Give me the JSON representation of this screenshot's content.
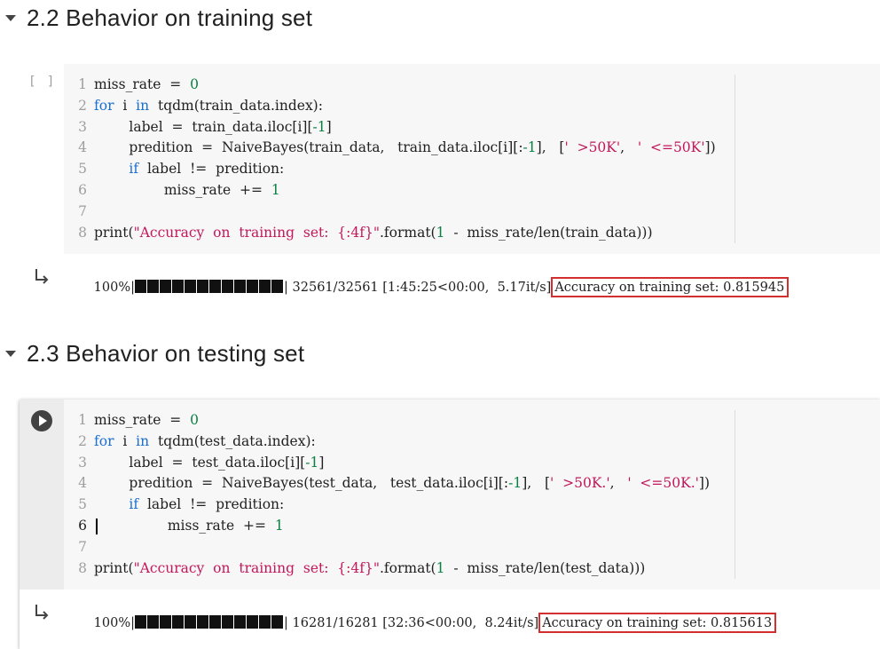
{
  "sections": [
    {
      "title": "2.2 Behavior on training set",
      "cell": {
        "state_marker": "[ ]",
        "lines": [
          "1",
          "2",
          "3",
          "4",
          "5",
          "6",
          "7",
          "8"
        ],
        "output": {
          "percent": "100%",
          "progress": 1.0,
          "stats": " 32561/32561 [1:45:25<00:00,  5.17it/s]",
          "result": "Accuracy on training set: 0.815945"
        }
      }
    },
    {
      "title": "2.3 Behavior on testing set",
      "cell": {
        "lines": [
          "1",
          "2",
          "3",
          "4",
          "5",
          "6",
          "7",
          "8"
        ],
        "output": {
          "percent": "100%",
          "progress": 1.0,
          "stats": " 16281/16281 [32:36<00:00,  8.24it/s]",
          "result": "Accuracy on training set: 0.815613"
        }
      }
    }
  ],
  "code_train": [
    [
      [
        "miss_rate  =  ",
        ""
      ],
      [
        "0",
        "num"
      ]
    ],
    [
      [
        "for",
        "kw"
      ],
      [
        "  i  ",
        ""
      ],
      [
        "in",
        "kw"
      ],
      [
        "  tqdm(train_data.index):",
        ""
      ]
    ],
    [
      [
        "        label  =  train_data.iloc[i][",
        ""
      ],
      [
        "-1",
        "num"
      ],
      [
        "]",
        ""
      ]
    ],
    [
      [
        "        predition  =  NaiveBayes(train_data,   train_data.iloc[i][:",
        ""
      ],
      [
        "-1",
        "num"
      ],
      [
        "],   [",
        ""
      ],
      [
        "'  >50K'",
        "str"
      ],
      [
        ",   ",
        ""
      ],
      [
        "'  <=50K'",
        "str"
      ],
      [
        "])",
        ""
      ]
    ],
    [
      [
        "        ",
        ""
      ],
      [
        "if",
        "kw"
      ],
      [
        "  label  !=  predition:",
        ""
      ]
    ],
    [
      [
        "                miss_rate  +=  ",
        ""
      ],
      [
        "1",
        "num"
      ]
    ],
    [
      [
        "",
        ""
      ]
    ],
    [
      [
        "print(",
        ""
      ],
      [
        "\"Accuracy  on  training  set:  {:4f}\"",
        "str"
      ],
      [
        ".format(",
        ""
      ],
      [
        "1",
        "num"
      ],
      [
        "  -  miss_rate/len(train_data)))",
        ""
      ]
    ]
  ],
  "code_test": [
    [
      [
        "miss_rate  =  ",
        ""
      ],
      [
        "0",
        "num"
      ]
    ],
    [
      [
        "for",
        "kw"
      ],
      [
        "  i  ",
        ""
      ],
      [
        "in",
        "kw"
      ],
      [
        "  tqdm(test_data.index):",
        ""
      ]
    ],
    [
      [
        "        label  =  test_data.iloc[i][",
        ""
      ],
      [
        "-1",
        "num"
      ],
      [
        "]",
        ""
      ]
    ],
    [
      [
        "        predition  =  NaiveBayes(test_data,   test_data.iloc[i][:",
        ""
      ],
      [
        "-1",
        "num"
      ],
      [
        "],   [",
        ""
      ],
      [
        "'  >50K.'",
        "str"
      ],
      [
        ",   ",
        ""
      ],
      [
        "'  <=50K.'",
        "str"
      ],
      [
        "])",
        ""
      ]
    ],
    [
      [
        "        ",
        ""
      ],
      [
        "if",
        "kw"
      ],
      [
        "  label  !=  predition:",
        ""
      ]
    ],
    [
      [
        "                miss_rate  +=  ",
        ""
      ],
      [
        "1",
        "num"
      ]
    ],
    [
      [
        "",
        ""
      ]
    ],
    [
      [
        "print(",
        ""
      ],
      [
        "\"Accuracy  on  training  set:  {:4f}\"",
        "str"
      ],
      [
        ".format(",
        ""
      ],
      [
        "1",
        "num"
      ],
      [
        "  -  miss_rate/len(test_data)))",
        ""
      ]
    ]
  ],
  "colors": {
    "keyword": "#1a6fd0",
    "number": "#0b8043",
    "string": "#c2185b",
    "highlight_box": "#d32f2f"
  },
  "icons": {
    "collapse": "caret-down-icon",
    "run": "play-circle-icon",
    "output": "output-arrow-icon"
  }
}
